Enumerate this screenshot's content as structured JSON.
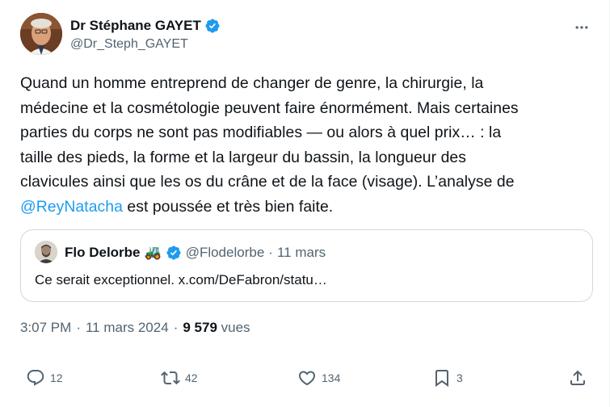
{
  "author": {
    "display_name": "Dr Stéphane GAYET",
    "handle": "@Dr_Steph_GAYET"
  },
  "tweet": {
    "lines": [
      "Quand un homme entreprend de changer de genre, la chirurgie, la",
      "médecine et la cosmétologie peuvent faire énormément. Mais certaines",
      "parties du corps ne sont pas modifiables — ou alors à quel prix… : la",
      "taille des pieds, la forme et la largeur du bassin, la longueur des",
      "clavicules ainsi que les os du crâne et de la face (visage). L’analyse de"
    ],
    "mention": "@ReyNatacha",
    "last_line_rest": " est poussée et très bien faite."
  },
  "quote": {
    "display_name": "Flo Delorbe",
    "emoji": "🚜",
    "handle": "@Flodelorbe",
    "separator": "·",
    "date": "11 mars",
    "text": "Ce serait exceptionnel. x.com/DeFabron/statu…"
  },
  "meta": {
    "time": "3:07 PM",
    "separator": "·",
    "date": "11 mars 2024",
    "views_count": "9 579",
    "views_label": "vues"
  },
  "actions": {
    "replies": "12",
    "retweets": "42",
    "likes": "134",
    "bookmarks": "3"
  },
  "icons": {
    "verified": "verified-badge-icon",
    "more": "more-dots-icon",
    "reply": "reply-icon",
    "retweet": "retweet-icon",
    "like": "heart-icon",
    "bookmark": "bookmark-icon",
    "share": "share-icon"
  },
  "colors": {
    "accent": "#1d9bf0",
    "text": "#0f1419",
    "secondary": "#536471",
    "border": "#cfd9de"
  }
}
